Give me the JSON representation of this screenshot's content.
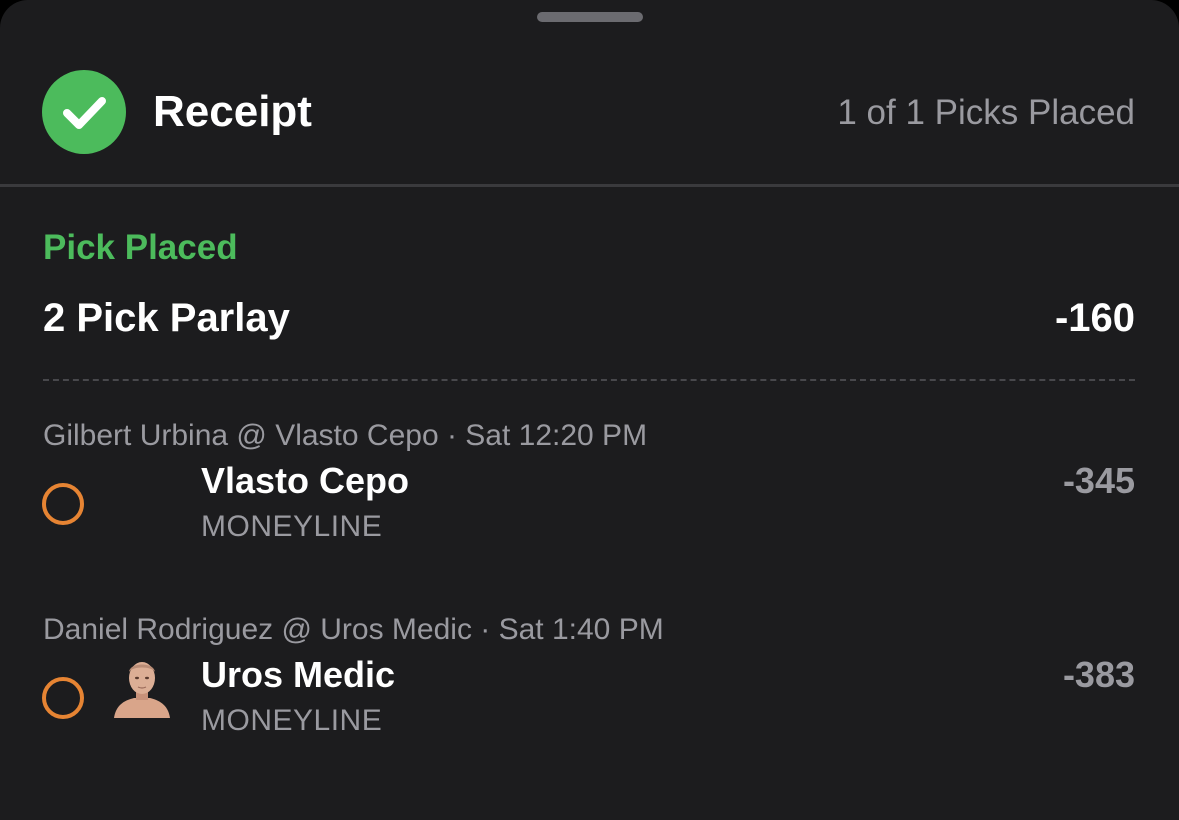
{
  "header": {
    "title": "Receipt",
    "picks_count": "1 of 1 Picks Placed",
    "status_icon": "check-circle-icon"
  },
  "colors": {
    "success": "#4cbb5c",
    "pending": "#e68433",
    "background": "#1c1c1e",
    "muted_text": "#9a9aa0"
  },
  "pick": {
    "status": "Pick Placed",
    "title": "2 Pick Parlay",
    "odds": "-160"
  },
  "legs": [
    {
      "event": "Gilbert Urbina @ Vlasto Cepo · Sat 12:20 PM",
      "selection": "Vlasto Cepo",
      "market": "MONEYLINE",
      "odds": "-345",
      "status_icon": "pending-circle-icon",
      "has_photo": false
    },
    {
      "event": "Daniel Rodriguez @ Uros Medic · Sat 1:40 PM",
      "selection": "Uros Medic",
      "market": "MONEYLINE",
      "odds": "-383",
      "status_icon": "pending-circle-icon",
      "has_photo": true
    }
  ]
}
